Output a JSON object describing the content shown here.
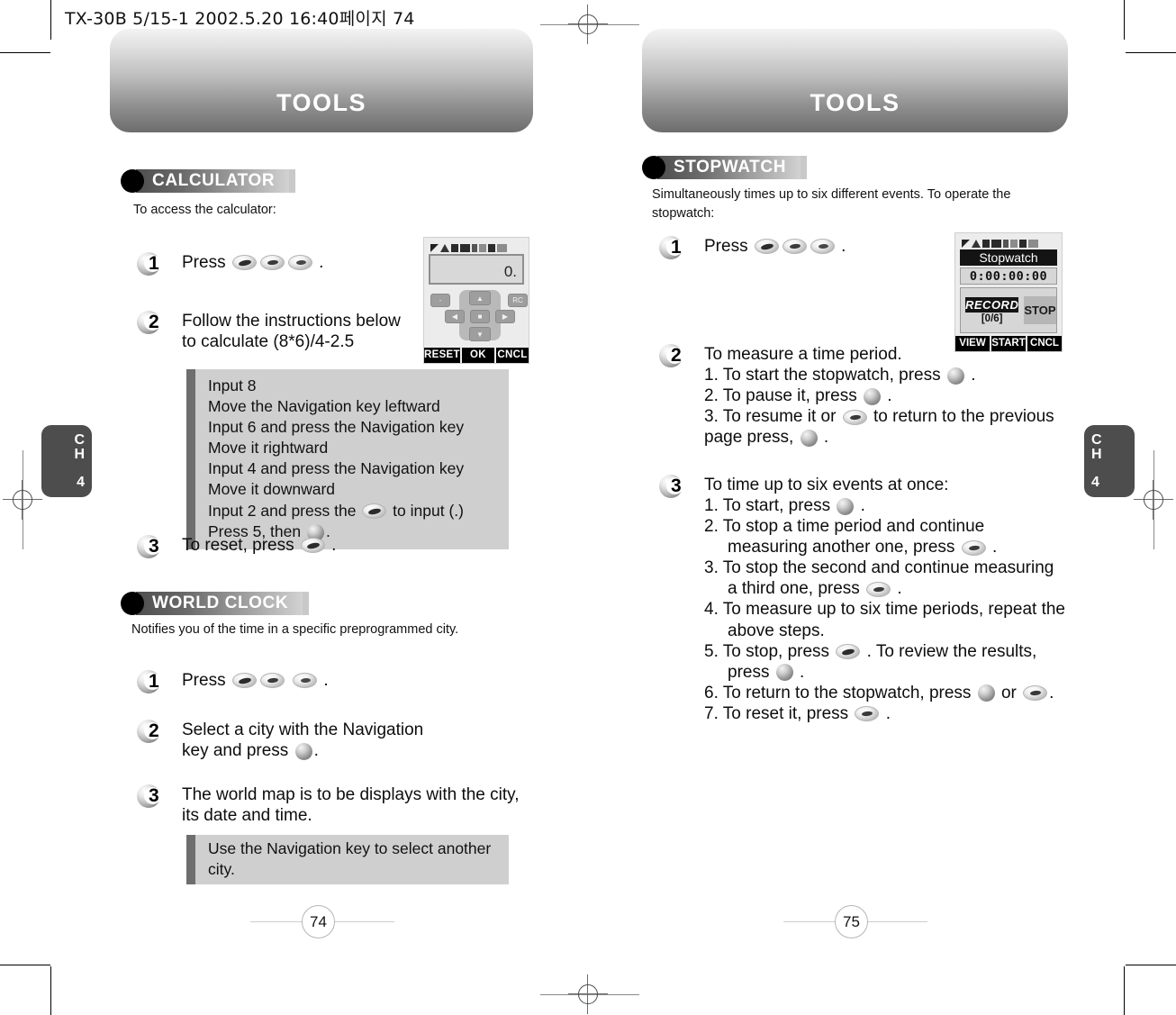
{
  "slugline": "TX-30B 5/15-1  2002.5.20 16:40페이지 74",
  "left_page": {
    "banner_title": "TOOLS",
    "chapter_tab": {
      "ch": "C",
      "h": "H",
      "num": "4"
    },
    "page_number": "74",
    "sections": [
      {
        "heading": "CALCULATOR",
        "intro": "To access the calculator:",
        "steps": [
          {
            "num": "1",
            "text_before": "Press",
            "text_after": "."
          },
          {
            "num": "2",
            "line1": "Follow the instructions below",
            "line2": "to calculate (8*6)/4-2.5"
          },
          {
            "num": "3",
            "text_before": "To reset, press",
            "text_after": "."
          }
        ],
        "notebox_lines": [
          "Input 8",
          "Move the Navigation key leftward",
          "Input 6 and press the Navigation key",
          "Move it rightward",
          "Input 4 and press the Navigation key",
          "Move it downward",
          "Input 2 and press the",
          "to input (.)",
          "Press 5, then",
          "."
        ]
      },
      {
        "heading": "WORLD CLOCK",
        "intro": "Notifies you of the time in a specific preprogrammed city.",
        "steps": [
          {
            "num": "1",
            "text_before": "Press",
            "text_after": "."
          },
          {
            "num": "2",
            "line1": "Select a city with the Navigation",
            "line2a": "key and press",
            "line2b": "."
          },
          {
            "num": "3",
            "line1": "The world map is to be displays with the city,",
            "line2": "its date and time."
          }
        ],
        "notebox_single": "Use the Navigation key to select another city."
      }
    ],
    "calculator_screen": {
      "display_value": "0.",
      "keys": {
        "minus": "-",
        "rc": "RC",
        "up": "▲",
        "down": "▼",
        "left": "◀",
        "right": "▶",
        "center": "■"
      },
      "softkeys": [
        "RESET",
        "OK",
        "CNCL"
      ]
    }
  },
  "right_page": {
    "banner_title": "TOOLS",
    "chapter_tab": {
      "ch": "C",
      "h": "H",
      "num": "4"
    },
    "page_number": "75",
    "section": {
      "heading": "STOPWATCH",
      "intro_line1": "Simultaneously times up to six different events. To operate the",
      "intro_line2": "stopwatch:",
      "steps": [
        {
          "num": "1",
          "text_before": "Press",
          "text_after": "."
        },
        {
          "num": "2",
          "title": "To measure a time period.",
          "items": [
            {
              "a": "1. To start the stopwatch, press",
              "b": "."
            },
            {
              "a": "2. To pause it, press",
              "b": "."
            },
            {
              "a": "3. To resume it or",
              "b": "to return to the previous"
            },
            {
              "a": "page press,",
              "b": "."
            }
          ]
        },
        {
          "num": "3",
          "title": "To time up to six events at once:",
          "items": [
            {
              "a": "1. To start, press",
              "b": "."
            },
            {
              "a": "2. To stop a time period and continue",
              "b": ""
            },
            {
              "a": "measuring another one, press",
              "b": "."
            },
            {
              "a": "3. To stop the second and continue measuring",
              "b": ""
            },
            {
              "a": "a third one, press",
              "b": "."
            },
            {
              "a": "4. To measure up to six time periods, repeat the",
              "b": ""
            },
            {
              "a": "above steps.",
              "b": ""
            },
            {
              "a": "5. To stop, press",
              "b": ". To review the results,"
            },
            {
              "a": "press",
              "b": "."
            },
            {
              "a": "6. To return to the stopwatch, press",
              "b": "or",
              "c": "."
            },
            {
              "a": "7. To reset it, press",
              "b": "."
            }
          ]
        }
      ]
    },
    "stopwatch_screen": {
      "title": "Stopwatch",
      "time": "0:00:00:00",
      "record_tag": "RECORD",
      "record_count": "[0/6]",
      "stop_label": "STOP",
      "softkeys": [
        "VIEW",
        "START",
        "CNCL"
      ]
    }
  }
}
